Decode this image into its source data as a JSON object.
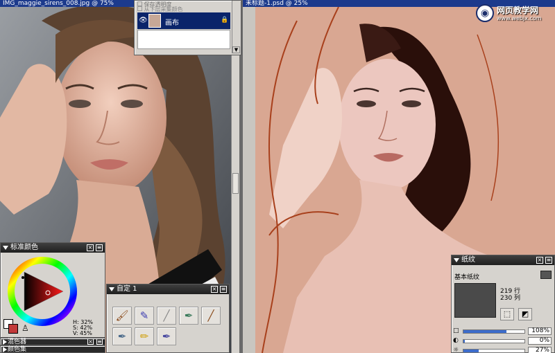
{
  "left_document": {
    "title": "IMG_maggie_sirens_008.jpg @ 75%"
  },
  "right_document": {
    "title": "未标题-1.psd @ 25%"
  },
  "watermark": {
    "line1": "网页教学网",
    "line2": "www.webjx.com"
  },
  "layers_panel": {
    "option1": "保存透明度",
    "option2": "从下层采集颜色",
    "layer_name": "画布"
  },
  "color_palette": {
    "title": "标准颜色",
    "h": "H: 32%",
    "s": "S: 42%",
    "v": "V: 45%",
    "main_color": "#c23a3a",
    "secondary_color": "#ffffff"
  },
  "collapsed_palettes": {
    "mixer": "混色器",
    "color_set": "颜色集"
  },
  "custom_palette": {
    "title": "自定 1"
  },
  "paper_palette": {
    "title": "纸纹",
    "paper_name": "基本纸纹",
    "rows": "219 行",
    "cols": "230 列",
    "scale": "108%",
    "contrast": "0%",
    "brightness": "27%",
    "scale_value": 0.7,
    "contrast_value": 0.02,
    "brightness_value": 0.25
  }
}
